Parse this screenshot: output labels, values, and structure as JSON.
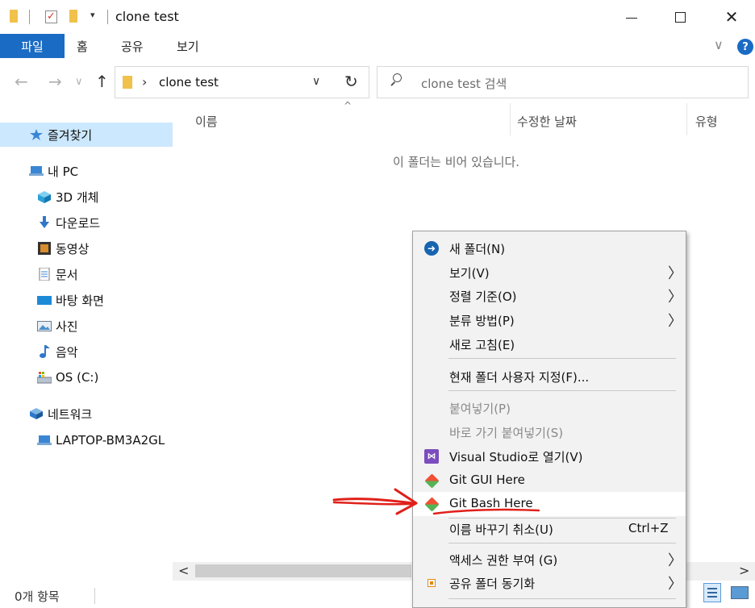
{
  "window": {
    "title": "clone test",
    "minimize_icon": "minimize-icon",
    "maximize_icon": "maximize-icon",
    "close_glyph": "✕"
  },
  "ribbon": {
    "tabs": [
      "파일",
      "홈",
      "공유",
      "보기"
    ],
    "accent_color": "#1a6bc4",
    "expand_glyph": "∨",
    "help_glyph": "?"
  },
  "address": {
    "back_glyph": "←",
    "forward_glyph": "→",
    "recent_glyph": "∨",
    "up_glyph": "↑",
    "separator_glyph": "›",
    "path": "clone test",
    "dropdown_glyph": "∨",
    "refresh_glyph": "↻"
  },
  "search": {
    "placeholder": "clone test 검색"
  },
  "nav": {
    "items": [
      {
        "label": "즐겨찾기",
        "icon": "star-icon",
        "selected": true
      },
      {
        "label": "내 PC",
        "icon": "computer-icon"
      },
      {
        "label": "3D 개체",
        "icon": "cube-icon"
      },
      {
        "label": "다운로드",
        "icon": "download-icon"
      },
      {
        "label": "동영상",
        "icon": "film-icon"
      },
      {
        "label": "문서",
        "icon": "document-icon"
      },
      {
        "label": "바탕 화면",
        "icon": "desktop-icon"
      },
      {
        "label": "사진",
        "icon": "picture-icon"
      },
      {
        "label": "음악",
        "icon": "music-icon"
      },
      {
        "label": "OS (C:)",
        "icon": "drive-icon"
      },
      {
        "label": "네트워크",
        "icon": "network-icon"
      },
      {
        "label": "LAPTOP-BM3A2GL",
        "icon": "computer-icon"
      }
    ]
  },
  "content": {
    "sort_glyph": "^",
    "columns": [
      "이름",
      "수정한 날짜",
      "유형"
    ],
    "empty_message": "이 폴더는 비어 있습니다."
  },
  "scrollbar": {
    "left_glyph": "<",
    "right_glyph": ">"
  },
  "status": {
    "item_count": "0개 항목"
  },
  "context_menu": {
    "submenu_glyph": "〉",
    "items": [
      {
        "label": "새 폴더(N)",
        "icon": "new-folder-icon"
      },
      {
        "label": "보기(V)",
        "submenu": true
      },
      {
        "label": "정렬 기준(O)",
        "submenu": true
      },
      {
        "label": "분류 방법(P)",
        "submenu": true
      },
      {
        "label": "새로 고침(E)"
      },
      {
        "label": "현재 폴더 사용자 지정(F)..."
      },
      {
        "label": "붙여넣기(P)",
        "disabled": true
      },
      {
        "label": "바로 가기 붙여넣기(S)",
        "disabled": true
      },
      {
        "label": "Visual Studio로 열기(V)",
        "icon": "visual-studio-icon"
      },
      {
        "label": "Git GUI Here",
        "icon": "git-icon"
      },
      {
        "label": "Git Bash Here",
        "icon": "git-icon",
        "highlighted": true
      },
      {
        "label": "이름 바꾸기 취소(U)",
        "shortcut": "Ctrl+Z"
      },
      {
        "label": "액세스 권한 부여 (G)",
        "submenu": true
      },
      {
        "label": "공유 폴더 동기화",
        "icon": "share-sync-icon",
        "submenu": true
      }
    ]
  },
  "annotation": {
    "color": "#e0201a",
    "marker": "red-arrow"
  }
}
